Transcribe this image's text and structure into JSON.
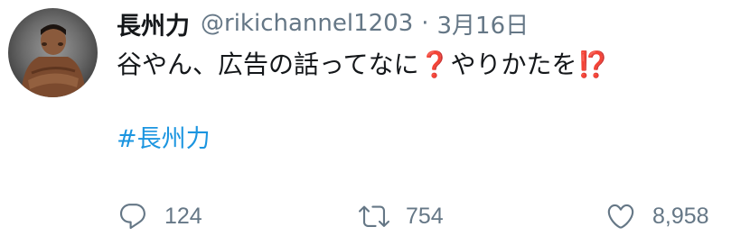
{
  "tweet": {
    "display_name": "長州力",
    "handle": "@rikichannel1203",
    "separator": "·",
    "date": "3月16日",
    "text_part1": "谷やん、広告の話ってなに",
    "emoji_question": "❓",
    "text_part2": "やりかたを",
    "emoji_interrobang": "⁉️",
    "hashtag": "#長州力"
  },
  "actions": {
    "reply_count": "124",
    "retweet_count": "754",
    "like_count": "8,958"
  },
  "colors": {
    "text": "#14171a",
    "secondary": "#657786",
    "link": "#1b95e0",
    "emoji_red": "#d0161f"
  },
  "icons": {
    "reply": "reply-icon",
    "retweet": "retweet-icon",
    "like": "heart-icon"
  }
}
